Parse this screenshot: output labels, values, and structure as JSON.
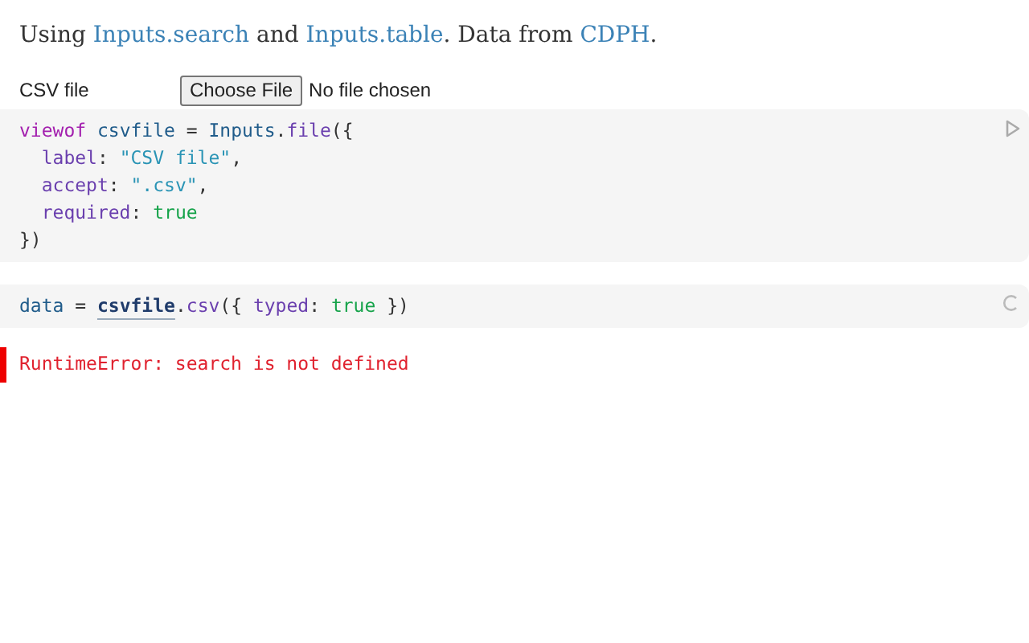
{
  "intro": [
    {
      "kind": "text",
      "text": "Using "
    },
    {
      "kind": "link",
      "text": "Inputs.search"
    },
    {
      "kind": "text",
      "text": " and "
    },
    {
      "kind": "link",
      "text": "Inputs.table"
    },
    {
      "kind": "text",
      "text": ". Data from "
    },
    {
      "kind": "link",
      "text": "CDPH"
    },
    {
      "kind": "text",
      "text": "."
    }
  ],
  "file_input": {
    "label": "CSV file",
    "button": "Choose File",
    "status": "No file chosen"
  },
  "cells": [
    {
      "kind": "run",
      "lines": [
        [
          {
            "kind": "keyword",
            "text": "viewof "
          },
          {
            "kind": "def",
            "text": "csvfile"
          },
          {
            "kind": "plain",
            "text": " = "
          },
          {
            "kind": "def",
            "text": "Inputs"
          },
          {
            "kind": "plain",
            "text": "."
          },
          {
            "kind": "prop",
            "text": "file"
          },
          {
            "kind": "plain",
            "text": "({"
          }
        ],
        [
          {
            "kind": "prop",
            "text": "  label"
          },
          {
            "kind": "plain",
            "text": ": "
          },
          {
            "kind": "string",
            "text": "\"CSV file\""
          },
          {
            "kind": "plain",
            "text": ","
          }
        ],
        [
          {
            "kind": "prop",
            "text": "  accept"
          },
          {
            "kind": "plain",
            "text": ": "
          },
          {
            "kind": "string",
            "text": "\".csv\""
          },
          {
            "kind": "plain",
            "text": ","
          }
        ],
        [
          {
            "kind": "prop",
            "text": "  required"
          },
          {
            "kind": "plain",
            "text": ": "
          },
          {
            "kind": "atom",
            "text": "true"
          }
        ],
        [
          {
            "kind": "plain",
            "text": "})"
          }
        ]
      ]
    },
    {
      "kind": "pending",
      "lines": [
        [
          {
            "kind": "def",
            "text": "data"
          },
          {
            "kind": "plain",
            "text": " = "
          },
          {
            "kind": "ref",
            "text": "csvfile"
          },
          {
            "kind": "plain",
            "text": "."
          },
          {
            "kind": "prop",
            "text": "csv"
          },
          {
            "kind": "plain",
            "text": "({ "
          },
          {
            "kind": "prop",
            "text": "typed"
          },
          {
            "kind": "plain",
            "text": ": "
          },
          {
            "kind": "atom",
            "text": "true"
          },
          {
            "kind": "plain",
            "text": " })"
          }
        ]
      ]
    }
  ],
  "error": "RuntimeError: search is not defined"
}
